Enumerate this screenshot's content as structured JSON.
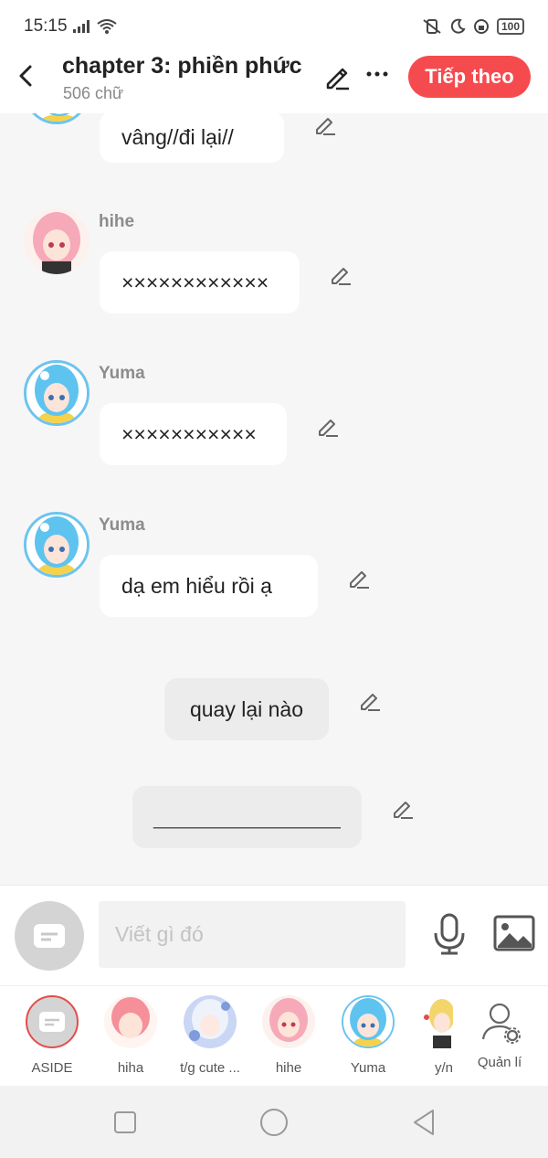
{
  "status_bar": {
    "time": "15:15",
    "battery": "100"
  },
  "header": {
    "title": "chapter 3: phiền phức",
    "word_count": "506 chữ",
    "next_label": "Tiếp theo"
  },
  "messages": [
    {
      "sender": "",
      "text": "vâng//đi lại//"
    },
    {
      "sender": "hihe",
      "text": "××××××××××××"
    },
    {
      "sender": "Yuma",
      "text": "×××××××××××"
    },
    {
      "sender": "Yuma",
      "text": "dạ em hiểu rồi ạ"
    },
    {
      "sender": "",
      "text": "quay lại nào"
    },
    {
      "sender": "",
      "text": "________________"
    }
  ],
  "composer": {
    "placeholder": "Viết gì đó"
  },
  "characters": [
    "ASIDE",
    "hiha",
    "t/g cute ...",
    "hihe",
    "Yuma",
    "y/n",
    "Quản lí"
  ],
  "colors": {
    "accent": "#f54b4f",
    "yuma_ring": "#6cc4ef"
  }
}
